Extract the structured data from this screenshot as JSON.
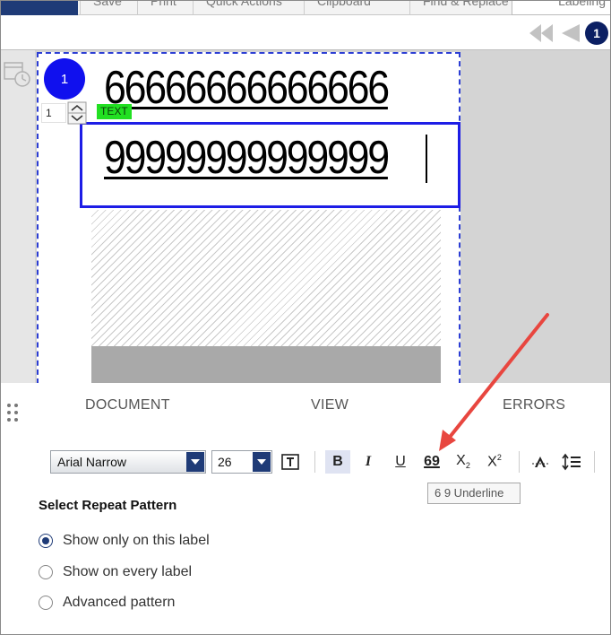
{
  "ribbon": {
    "tabs": [
      "Save",
      "Print",
      "Quick Actions",
      "Clipboard",
      "Find & Replace",
      "Labeling"
    ]
  },
  "nav": {
    "page_badge": "1"
  },
  "editor": {
    "label_number": "1",
    "copies_value": "1",
    "object_tag": "TEXT",
    "line1_text": "66666666666666",
    "line2_text": "99999999999999"
  },
  "panel": {
    "tabs": [
      "DOCUMENT",
      "VIEW",
      "ERRORS"
    ],
    "font_family_value": "Arial Narrow",
    "font_size_value": "26",
    "tooltip": "6 9 Underline",
    "repeat": {
      "title": "Select Repeat Pattern",
      "options": [
        {
          "label": "Show only on this label",
          "checked": true
        },
        {
          "label": "Show on every label",
          "checked": false
        },
        {
          "label": "Advanced pattern",
          "checked": false
        }
      ]
    }
  },
  "colors": {
    "brand_navy": "#1f3b77",
    "label_badge": "#1010ee",
    "selection": "#1d1de6",
    "text_tag": "#22e022",
    "annotation_arrow": "#e8463f"
  }
}
